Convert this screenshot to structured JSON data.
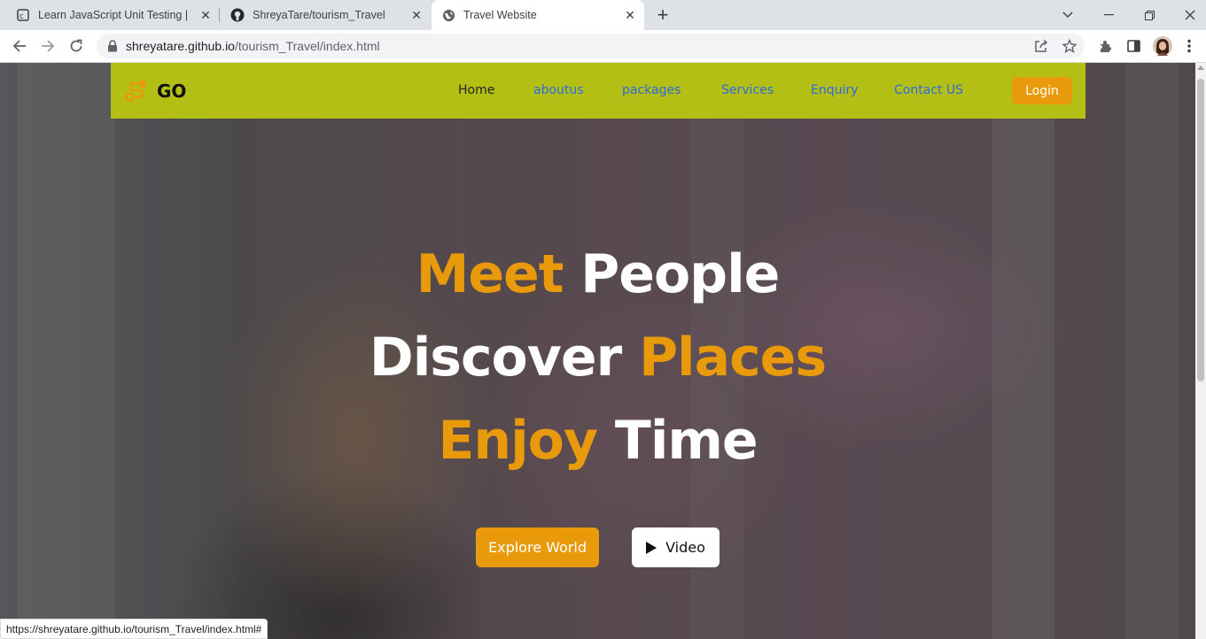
{
  "browser": {
    "tabs": [
      {
        "title": "Learn JavaScript Unit Testing | Co",
        "icon": "codedamn-icon",
        "active": false
      },
      {
        "title": "ShreyaTare/tourism_Travel",
        "icon": "github-icon",
        "active": false
      },
      {
        "title": "Travel Website",
        "icon": "globe-icon",
        "active": true
      }
    ],
    "url_domain": "shreyatare.github.io",
    "url_path": "/tourism_Travel/index.html",
    "status_url": "https://shreyatare.github.io/tourism_Travel/index.html#"
  },
  "site": {
    "logo_text": "GO",
    "nav": {
      "home": "Home",
      "aboutus": "aboutus",
      "packages": "packages",
      "services": "Services",
      "enquiry": "Enquiry",
      "contact": "Contact US"
    },
    "login_label": "Login",
    "hero": {
      "line1_accent": "Meet",
      "line1_rest": " People",
      "line2_start": "Discover ",
      "line2_accent": "Places",
      "line3_accent": "Enjoy",
      "line3_rest": " Time"
    },
    "explore_label": "Explore World",
    "video_label": "Video"
  },
  "colors": {
    "accent": "#e89a0b",
    "nav_bg": "#b4bf15",
    "link": "#2d6be0"
  }
}
